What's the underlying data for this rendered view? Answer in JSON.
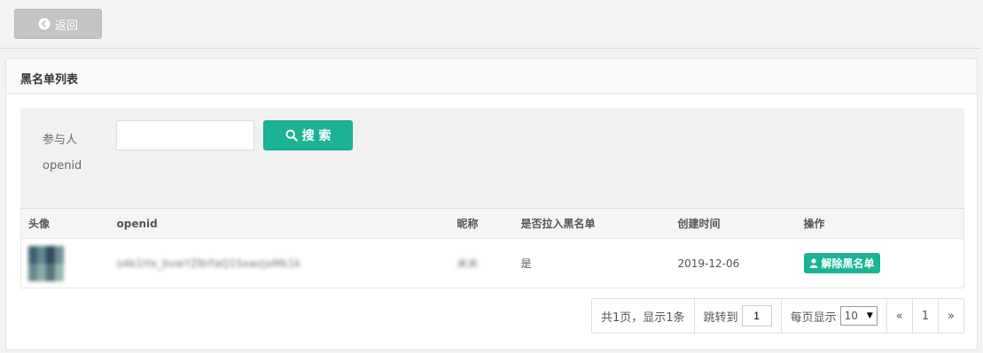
{
  "toolbar": {
    "back_label": "返回"
  },
  "panel": {
    "title": "黑名单列表"
  },
  "search": {
    "label_line1": "参与人",
    "label_line2": "openid",
    "input_value": "",
    "button_label": "搜 索"
  },
  "table": {
    "headers": [
      "头像",
      "openid",
      "昵称",
      "是否拉入黑名单",
      "创建时间",
      "操作"
    ],
    "rows": [
      {
        "openid": "o4k1Hx_bvwYZ8rFaQ1SxwzjxMk1k",
        "nickname": "米米",
        "is_blacklisted": "是",
        "created": "2019-12-06",
        "action_label": "解除黑名单"
      }
    ]
  },
  "pagination": {
    "summary": "共1页，显示1条",
    "jump_label": "跳转到",
    "jump_value": "1",
    "page_size_label": "每页显示",
    "page_size_value": "10",
    "prev_label": "«",
    "current_page": "1",
    "next_label": "»"
  },
  "colors": {
    "primary": "#1ab394",
    "back_button": "#c4c4c4"
  }
}
